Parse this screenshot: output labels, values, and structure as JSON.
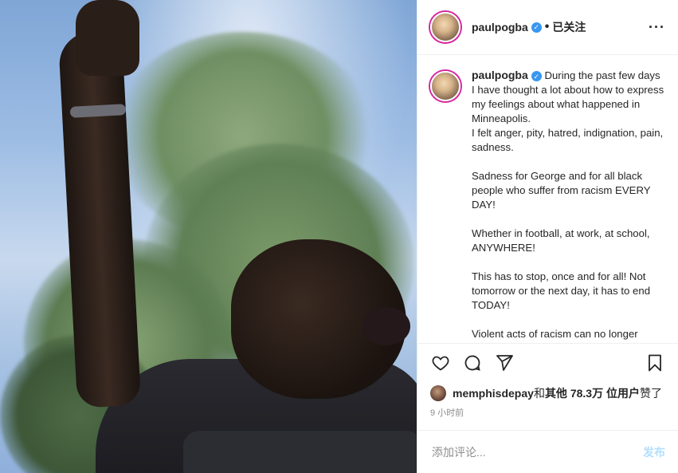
{
  "post": {
    "username": "paulpogba",
    "follow_status": "已关注",
    "more_icon": "more-horizontal-icon",
    "caption": "During the past few days I have thought a lot about how to express my feelings about what happened in Minneapolis.\nI felt anger, pity, hatred, indignation, pain, sadness.\n\nSadness for George and for all black people who suffer from racism EVERY DAY!\n\nWhether in football, at work, at school, ANYWHERE!\n\nThis has to stop, once and for all! Not tomorrow or the next day, it has to end TODAY!\n\nViolent acts of racism can no longer",
    "likes": {
      "user": "memphisdepay",
      "middle": " 和 ",
      "others": "其他 78.3万 位用户",
      "suffix": " 赞了"
    },
    "time": "9 小时前",
    "comment": {
      "placeholder": "添加评论...",
      "post_label": "发布"
    }
  },
  "icons": [
    "heart-icon",
    "comment-icon",
    "share-icon",
    "bookmark-icon",
    "verified-icon"
  ],
  "colors": {
    "verified": "#3897f0",
    "post_button": "#b2dffc",
    "text": "#262626",
    "muted": "#8e8e8e"
  }
}
